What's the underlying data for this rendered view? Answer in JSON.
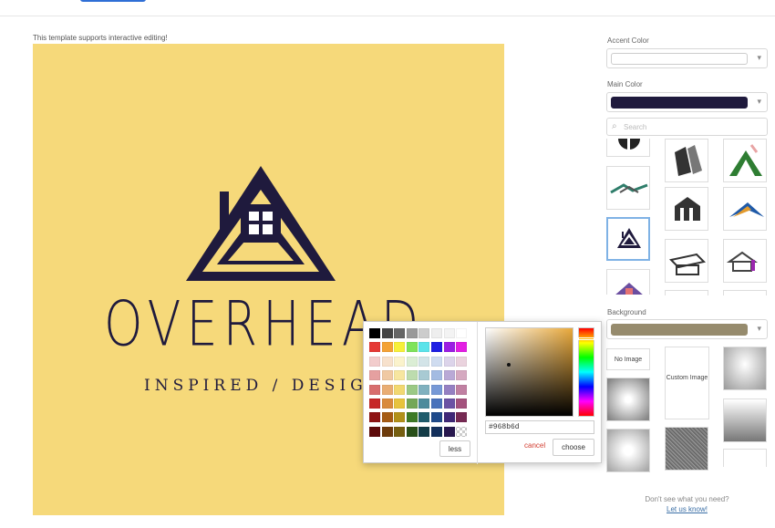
{
  "note": "This template supports interactive editing!",
  "logo": {
    "name": "OVERHEAD",
    "tagline": "INSPIRED / DESIGN"
  },
  "sidebar": {
    "accent_label": "Accent Color",
    "main_label": "Main Color",
    "search_placeholder": "Search",
    "background_label": "Background",
    "no_image": "No Image",
    "custom_image": "Custom Image",
    "help_text": "Don't see what you need?",
    "help_link": "Let us know!"
  },
  "colors": {
    "canvas": "#f6d97a",
    "main": "#1f1a3d",
    "background_swatch": "#968b6d",
    "accent": "#ffffff"
  },
  "picker": {
    "hex": "#968b6d",
    "less": "less",
    "cancel": "cancel",
    "choose": "choose"
  }
}
